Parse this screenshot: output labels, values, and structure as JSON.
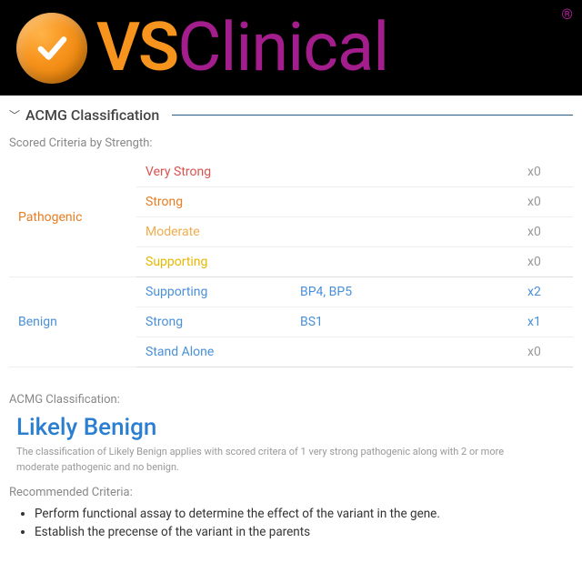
{
  "brand": {
    "vs": "VS",
    "clinical": "Clinical",
    "reg": "®"
  },
  "section": {
    "title": "ACMG Classification"
  },
  "scored_label": "Scored Criteria by Strength:",
  "categories": {
    "pathogenic": "Pathogenic",
    "benign": "Benign"
  },
  "rows": {
    "p_vstrong": {
      "strength": "Very Strong",
      "codes": "",
      "count": "x0"
    },
    "p_strong": {
      "strength": "Strong",
      "codes": "",
      "count": "x0"
    },
    "p_mod": {
      "strength": "Moderate",
      "codes": "",
      "count": "x0"
    },
    "p_supp": {
      "strength": "Supporting",
      "codes": "",
      "count": "x0"
    },
    "b_supp": {
      "strength": "Supporting",
      "codes": "BP4, BP5",
      "count": "x2"
    },
    "b_strong": {
      "strength": "Strong",
      "codes": "BS1",
      "count": "x1"
    },
    "b_stand": {
      "strength": "Stand Alone",
      "codes": "",
      "count": "x0"
    }
  },
  "classification": {
    "label": "ACMG Classification:",
    "value": "Likely Benign",
    "explain": "The classification of Likely Benign applies with scored critera of 1 very strong pathogenic along with 2 or more moderate pathogenic and no benign."
  },
  "recommended": {
    "label": "Recommended Criteria:",
    "items": {
      "0": "Perform functional assay to determine the effect of the variant in the gene.",
      "1": "Establish the precense of the variant in the parents"
    }
  }
}
